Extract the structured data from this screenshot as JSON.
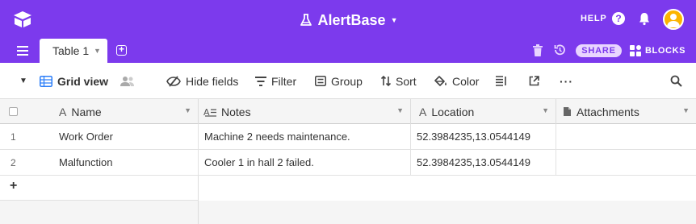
{
  "app": {
    "title": "AlertBase",
    "help_label": "HELP",
    "help_icon_glyph": "?",
    "brand_color": "#7c3aed"
  },
  "tabs": {
    "active_label": "Table 1",
    "share_label": "SHARE",
    "blocks_label": "BLOCKS"
  },
  "toolbar": {
    "view_label": "Grid view",
    "hide_fields_label": "Hide fields",
    "filter_label": "Filter",
    "group_label": "Group",
    "sort_label": "Sort",
    "color_label": "Color",
    "more_label": "···"
  },
  "grid": {
    "columns": [
      {
        "label": "Name",
        "icon": "text-icon"
      },
      {
        "label": "Notes",
        "icon": "long-text-icon"
      },
      {
        "label": "Location",
        "icon": "text-icon"
      },
      {
        "label": "Attachments",
        "icon": "attachment-icon"
      }
    ],
    "rows": [
      {
        "num": "1",
        "name": "Work Order",
        "notes": "Machine 2 needs maintenance.",
        "location": "52.3984235,13.0544149",
        "attachments": ""
      },
      {
        "num": "2",
        "name": "Malfunction",
        "notes": "Cooler 1 in hall 2 failed.",
        "location": "52.3984235,13.0544149",
        "attachments": ""
      }
    ],
    "add_row_glyph": "+"
  }
}
